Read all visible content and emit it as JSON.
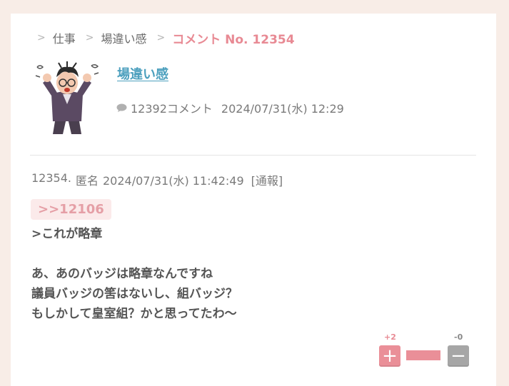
{
  "breadcrumb": {
    "items": [
      "仕事",
      "場違い感"
    ],
    "current": "コメント No. 12354"
  },
  "topic": {
    "title": "場違い感",
    "comment_count_text": "12392コメント",
    "datetime": "2024/07/31(水) 12:29",
    "avatar_icon": "confused-man-illustration",
    "comment_icon": "speech-bubble-icon"
  },
  "comment": {
    "number": "12354.",
    "author": "匿名",
    "datetime": "2024/07/31(水) 11:42:49",
    "report_label": "[通報]",
    "reply_anchor": ">>12106",
    "lines": [
      ">これが略章",
      "",
      "あ、あのバッジは略章なんですね",
      "議員バッジの筈はないし、組バッジ？",
      "もしかして皇室組？かと思ってたわ〜"
    ]
  },
  "votes": {
    "plus_count": "+2",
    "minus_count": "-0",
    "plus_symbol": "+",
    "minus_symbol": "−",
    "plus_ratio": 1.0,
    "plus_color": "#ea8f98",
    "minus_color": "#a6a6a6"
  },
  "colors": {
    "accent_pink": "#e88a94",
    "link_blue": "#4da0be",
    "background": "#f8ede7"
  }
}
